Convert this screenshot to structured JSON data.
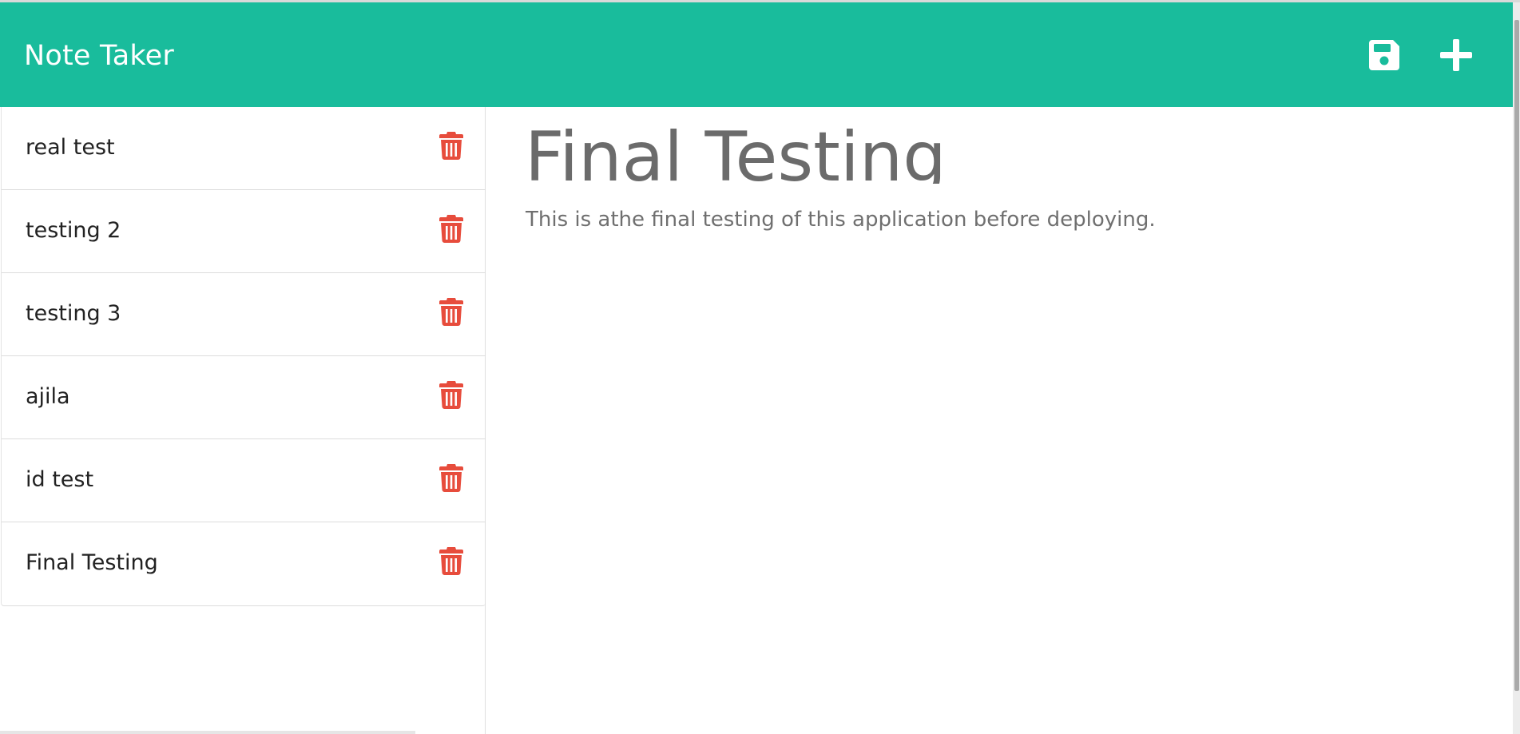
{
  "app": {
    "title": "Note Taker"
  },
  "toolbar": {
    "save_icon": "save-icon",
    "new_note_icon": "plus-icon"
  },
  "colors": {
    "header": "#19bc9c",
    "delete": "#e74c3c",
    "heading_text": "#6b6b6b",
    "body_text": "#6f6f6f"
  },
  "notes": [
    {
      "title": "real test",
      "icon": "trash-icon"
    },
    {
      "title": "testing 2",
      "icon": "trash-icon"
    },
    {
      "title": "testing 3",
      "icon": "trash-icon"
    },
    {
      "title": "ajila",
      "icon": "trash-icon"
    },
    {
      "title": "id test",
      "icon": "trash-icon"
    },
    {
      "title": "Final Testing",
      "icon": "trash-icon"
    }
  ],
  "active_note": {
    "title": "Final Testing",
    "text": "This is athe final testing of this application before deploying."
  }
}
